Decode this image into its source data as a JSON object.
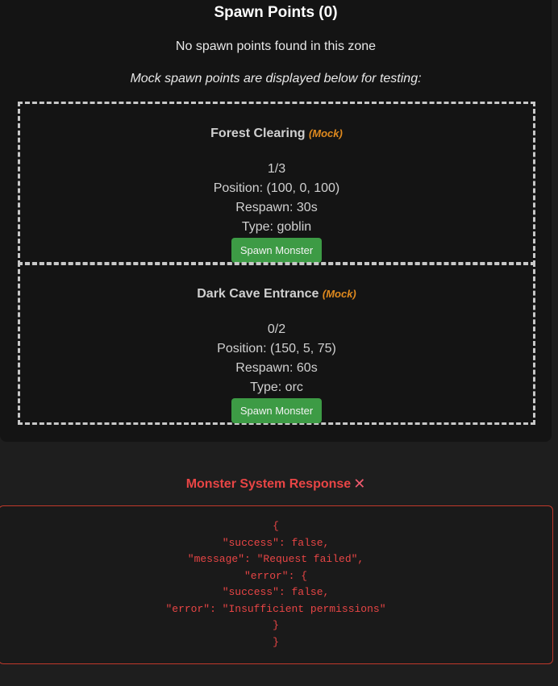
{
  "spawn_points": {
    "title": "Spawn Points (0)",
    "empty_message": "No spawn points found in this zone",
    "mock_message": "Mock spawn points are displayed below for testing:",
    "items": [
      {
        "name": "Forest Clearing",
        "tag": "(Mock)",
        "count": "1/3",
        "position": "Position: (100, 0, 100)",
        "respawn": "Respawn: 30s",
        "type": "Type: goblin",
        "button_label": "Spawn Monster"
      },
      {
        "name": "Dark Cave Entrance",
        "tag": "(Mock)",
        "count": "0/2",
        "position": "Position: (150, 5, 75)",
        "respawn": "Respawn: 60s",
        "type": "Type: orc",
        "button_label": "Spawn Monster"
      }
    ]
  },
  "response": {
    "title": "Monster System Response",
    "status_icon": "x-icon",
    "json_lines": [
      "{",
      "\"success\": false,",
      "\"message\": \"Request failed\",",
      "\"error\": {",
      "\"success\": false,",
      "\"error\": \"Insufficient permissions\"",
      "}",
      "}"
    ]
  },
  "colors": {
    "accent_error": "#e84545",
    "mock_tag": "#e08a1e",
    "button": "#3d9b45"
  }
}
